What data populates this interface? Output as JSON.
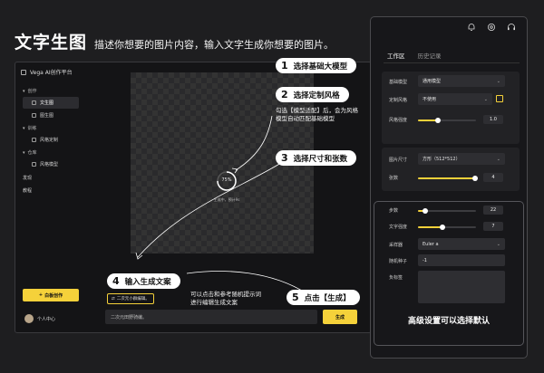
{
  "headline": {
    "title": "文字生图",
    "subtitle": "描述你想要的图片内容，输入文字生成你想要的图片。"
  },
  "app": {
    "name": "Vega AI创作平台",
    "nav": {
      "groups": [
        {
          "label": "创作",
          "items": [
            {
              "label": "文生图",
              "active": true
            },
            {
              "label": "图生图",
              "active": false
            }
          ]
        },
        {
          "label": "训练",
          "items": [
            {
              "label": "风格定制",
              "active": false
            }
          ]
        },
        {
          "label": "仓库",
          "items": [
            {
              "label": "风格模型",
              "active": false
            }
          ]
        }
      ],
      "discover": "发现",
      "tutorial": "教程"
    },
    "primary_button": "白板创作",
    "user": "个人中心",
    "progress_percent": "75%",
    "progress_status": "生成中，预计9s",
    "sample_chip": "二次元小群编辑。",
    "prompt_value": "二次元田野骑编。",
    "generate_button": "生成"
  },
  "callouts": [
    {
      "num": "1",
      "text": "选择基础大模型"
    },
    {
      "num": "2",
      "text": "选择定制风格"
    },
    {
      "num": "3",
      "text": "选择尺寸和张数"
    },
    {
      "num": "4",
      "text": "输入生成文案"
    },
    {
      "num": "5",
      "text": "点击【生成】"
    }
  ],
  "notes": {
    "style_note_1": "勾选【模型适配】后，会为风格",
    "style_note_2": "模型自动匹配基础模型",
    "prompt_note_1": "可以点击和参考随机提示词",
    "prompt_note_2": "进行编辑生成文案"
  },
  "panel": {
    "tabs": [
      {
        "label": "工作区",
        "active": true
      },
      {
        "label": "历史记录",
        "active": false
      }
    ],
    "base_model": {
      "label": "基础模型",
      "value": "通用模型"
    },
    "custom_style": {
      "label": "定制风格",
      "value": "不使用"
    },
    "style_strength": {
      "label": "风格强度",
      "value": "1.0",
      "fraction": 0.35
    },
    "image_size": {
      "label": "图片尺寸",
      "value": "方形（512*512）"
    },
    "count": {
      "label": "张数",
      "value": "4",
      "fraction": 0.98
    },
    "steps": {
      "label": "步数",
      "value": "22",
      "fraction": 0.12
    },
    "text_strength": {
      "label": "文字强度",
      "value": "7",
      "fraction": 0.42
    },
    "sampler": {
      "label": "采样器",
      "value": "Euler a"
    },
    "seed": {
      "label": "随机种子",
      "value": "-1"
    },
    "negative": {
      "label": "负标签",
      "value": ""
    },
    "advanced_caption": "高级设置可以选择默认"
  },
  "colors": {
    "accent": "#f5d13a",
    "background": "#1e1e20"
  }
}
